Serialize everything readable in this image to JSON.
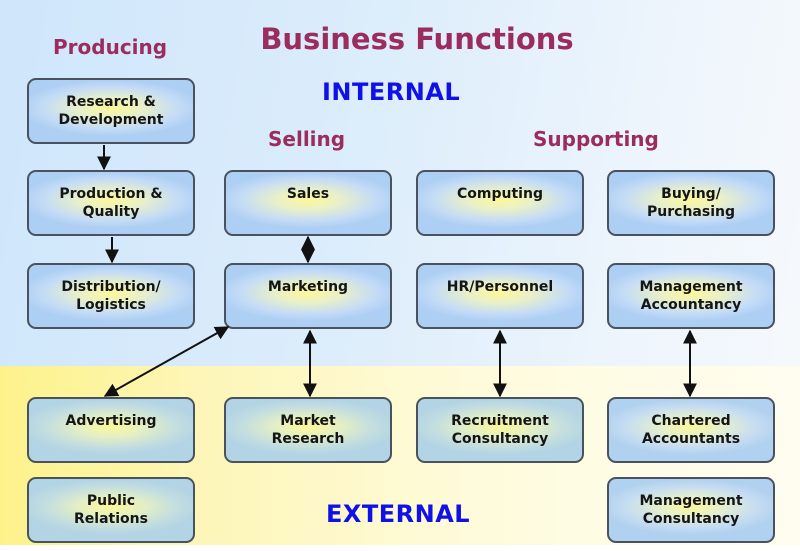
{
  "title": "Business Functions",
  "zones": {
    "internal": "INTERNAL",
    "external": "EXTERNAL"
  },
  "sections": {
    "producing": "Producing",
    "selling": "Selling",
    "supporting": "Supporting"
  },
  "colors": {
    "title": "#9b2c5e",
    "zone_label": "#1010e8",
    "internal_bg": "#dcedfb",
    "external_bg": "#fdf6b8",
    "box_border": "#4a5260"
  },
  "boxes": {
    "research_development": "Research &\nDevelopment",
    "production_quality": "Production &\nQuality",
    "distribution_logistics": "Distribution/\nLogistics",
    "sales": "Sales",
    "marketing": "Marketing",
    "computing": "Computing",
    "hr_personnel": "HR/Personnel",
    "buying_purchasing": "Buying/\nPurchasing",
    "management_accountancy": "Management\nAccountancy",
    "advertising": "Advertising",
    "public_relations": "Public\nRelations",
    "market_research": "Market\nResearch",
    "recruitment_consultancy": "Recruitment\nConsultancy",
    "chartered_accountants": "Chartered\nAccountants",
    "management_consultancy": "Management\nConsultancy"
  },
  "connections": [
    {
      "from": "research_development",
      "to": "production_quality",
      "type": "one-way"
    },
    {
      "from": "production_quality",
      "to": "distribution_logistics",
      "type": "one-way"
    },
    {
      "from": "sales",
      "to": "marketing",
      "type": "two-way"
    },
    {
      "from": "marketing",
      "to": "advertising",
      "type": "two-way"
    },
    {
      "from": "marketing",
      "to": "market_research",
      "type": "two-way"
    },
    {
      "from": "hr_personnel",
      "to": "recruitment_consultancy",
      "type": "two-way"
    },
    {
      "from": "management_accountancy",
      "to": "chartered_accountants",
      "type": "two-way"
    }
  ]
}
